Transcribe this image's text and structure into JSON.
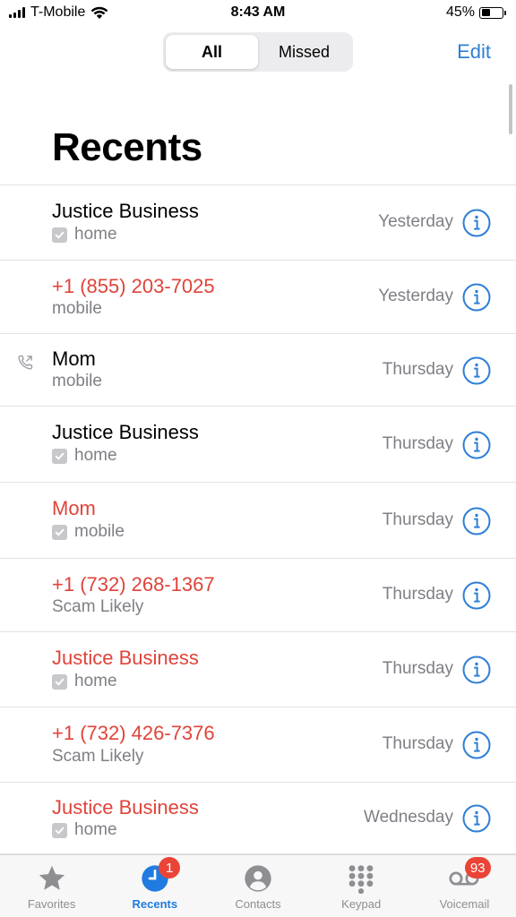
{
  "status_bar": {
    "carrier": "T-Mobile",
    "time": "8:43 AM",
    "battery_percent": "45%",
    "battery_level": 0.45
  },
  "segmented": {
    "all_label": "All",
    "missed_label": "Missed",
    "selected": "All"
  },
  "header": {
    "edit_label": "Edit",
    "title": "Recents"
  },
  "colors": {
    "accent": "#2e7fd6",
    "missed": "#e0433a",
    "secondary_text": "#7f7f85",
    "badge": "#ea4437"
  },
  "calls": [
    {
      "name": "Justice Business",
      "detail": "home",
      "date": "Yesterday",
      "missed": false,
      "checkbox": true,
      "outgoing": false
    },
    {
      "name": "+1 (855) 203-7025",
      "detail": "mobile",
      "date": "Yesterday",
      "missed": true,
      "checkbox": false,
      "outgoing": false
    },
    {
      "name": "Mom",
      "detail": "mobile",
      "date": "Thursday",
      "missed": false,
      "checkbox": false,
      "outgoing": true
    },
    {
      "name": "Justice Business",
      "detail": "home",
      "date": "Thursday",
      "missed": false,
      "checkbox": true,
      "outgoing": false
    },
    {
      "name": "Mom",
      "detail": "mobile",
      "date": "Thursday",
      "missed": true,
      "checkbox": true,
      "outgoing": false
    },
    {
      "name": "+1 (732) 268-1367",
      "detail": "Scam Likely",
      "date": "Thursday",
      "missed": true,
      "checkbox": false,
      "outgoing": false
    },
    {
      "name": "Justice Business",
      "detail": "home",
      "date": "Thursday",
      "missed": true,
      "checkbox": true,
      "outgoing": false
    },
    {
      "name": "+1 (732) 426-7376",
      "detail": "Scam Likely",
      "date": "Thursday",
      "missed": true,
      "checkbox": false,
      "outgoing": false
    },
    {
      "name": "Justice Business",
      "detail": "home",
      "date": "Wednesday",
      "missed": true,
      "checkbox": true,
      "outgoing": false
    }
  ],
  "tab_bar": {
    "favorites": {
      "label": "Favorites",
      "icon": "star-icon"
    },
    "recents": {
      "label": "Recents",
      "icon": "clock-icon",
      "badge": "1"
    },
    "contacts": {
      "label": "Contacts",
      "icon": "person-icon"
    },
    "keypad": {
      "label": "Keypad",
      "icon": "keypad-icon"
    },
    "voicemail": {
      "label": "Voicemail",
      "icon": "voicemail-icon",
      "badge": "93"
    }
  }
}
